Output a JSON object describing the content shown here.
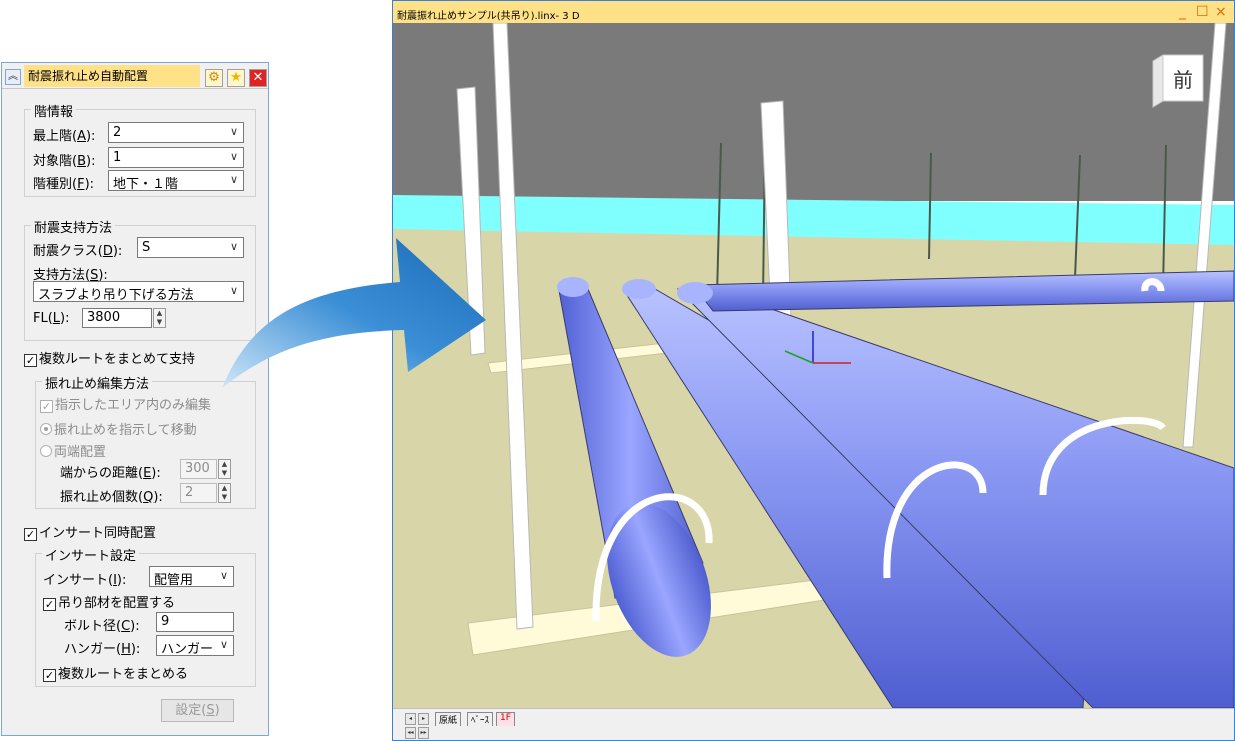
{
  "panel": {
    "title": "耐震振れ止め自動配置",
    "collapse_glyph": "︽",
    "floor_info": {
      "legend": "階情報",
      "top_floor": {
        "label": "最上階(",
        "key": "A",
        "tail": "):",
        "value": "2"
      },
      "target_floor": {
        "label": "対象階(",
        "key": "B",
        "tail": "):",
        "value": "1"
      },
      "floor_type": {
        "label": "階種別(",
        "key": "F",
        "tail": "):",
        "value": "地下・１階"
      }
    },
    "support": {
      "legend": "耐震支持方法",
      "class": {
        "label": "耐震クラス(",
        "key": "D",
        "tail": "):",
        "value": "S"
      },
      "method": {
        "label": "支持方法(",
        "key": "S",
        "tail": "):",
        "value": "スラブより吊り下げる方法"
      },
      "fl": {
        "label": "FL(",
        "key": "L",
        "tail": "):",
        "value": "3800"
      }
    },
    "multi_route": {
      "label": "複数ルートをまとめて支持",
      "edit_legend": "振れ止め編集方法",
      "only_area": "指示したエリア内のみ編集",
      "radio_move": "振れ止めを指示して移動",
      "radio_ends": "両端配置",
      "distance": {
        "label": "端からの距離(",
        "key": "E",
        "tail": "):",
        "value": "300"
      },
      "count": {
        "label": "振れ止め個数(",
        "key": "Q",
        "tail": "):",
        "value": "2"
      }
    },
    "insert": {
      "label": "インサート同時配置",
      "legend": "インサート設定",
      "insert_type": {
        "label": "インサート(",
        "key": "I",
        "tail": "):",
        "value": "配管用"
      },
      "hang_member": "吊り部材を配置する",
      "bolt": {
        "label": "ボルト径(",
        "key": "C",
        "tail": "):",
        "value": "9"
      },
      "hanger": {
        "label": "ハンガー(",
        "key": "H",
        "tail": "):",
        "value": "ハンガー"
      },
      "merge_routes": "複数ルートをまとめる"
    },
    "set_button": {
      "label": "設定(",
      "key": "S",
      "tail": ")"
    }
  },
  "window": {
    "title": "耐震振れ止めサンプル(共吊り).linx- 3 D",
    "minimize": "_",
    "maximize": "☐",
    "close": "×",
    "view_cube_label": "前",
    "tabs": [
      "原紙",
      "ﾍﾞｰｽ",
      "1F"
    ],
    "nav": [
      "◂",
      "▸",
      "◂◂",
      "▸▸"
    ]
  },
  "colors": {
    "title_bar": "#ffe287",
    "pipe": "#7f8cf0",
    "floor": "#d8d6a8",
    "cyan_band": "#80ffff",
    "ceiling": "#7a7a7a",
    "accent_arrow": "#2a7fc8"
  },
  "icons": {
    "gear": "gear-icon",
    "star": "star-icon",
    "close": "close-icon"
  }
}
